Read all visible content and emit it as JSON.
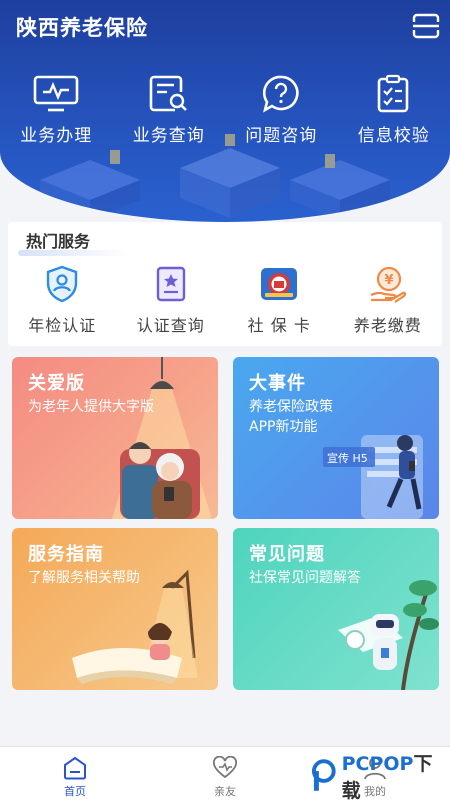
{
  "header": {
    "title": "陕西养老保险",
    "scan_icon": "scan-icon"
  },
  "quick_actions": [
    {
      "label": "业务办理",
      "icon": "monitor-icon"
    },
    {
      "label": "业务查询",
      "icon": "document-search-icon"
    },
    {
      "label": "问题咨询",
      "icon": "question-chat-icon"
    },
    {
      "label": "信息校验",
      "icon": "checklist-icon"
    }
  ],
  "hot_services": {
    "title": "热门服务",
    "items": [
      {
        "label": "年检认证",
        "icon": "shield-user-icon"
      },
      {
        "label": "认证查询",
        "icon": "certificate-icon"
      },
      {
        "label": "社 保 卡",
        "icon": "social-security-card-icon"
      },
      {
        "label": "养老缴费",
        "icon": "payment-hand-icon"
      }
    ]
  },
  "features": [
    {
      "title": "关爱版",
      "subtitle": "为老年人提供大字版"
    },
    {
      "title": "大事件",
      "subtitle": "养老保险政策\nAPP新功能",
      "badge": "宣传 H5"
    },
    {
      "title": "服务指南",
      "subtitle": "了解服务相关帮助"
    },
    {
      "title": "常见问题",
      "subtitle": "社保常见问题解答"
    }
  ],
  "tabbar": [
    {
      "label": "首页",
      "icon": "home-icon",
      "active": true
    },
    {
      "label": "亲友",
      "icon": "heart-icon",
      "active": false
    },
    {
      "label": "我的",
      "icon": "user-icon",
      "active": false
    }
  ],
  "watermark": {
    "brand_a": "PCPOP",
    "brand_b": "下载"
  },
  "colors": {
    "primary": "#2450b8",
    "tab_active": "#2a55c9"
  }
}
